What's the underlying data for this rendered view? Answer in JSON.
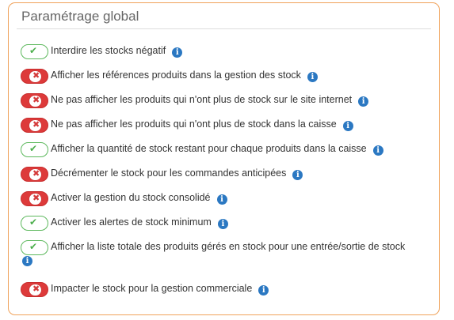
{
  "panel": {
    "title": "Paramétrage global"
  },
  "icons": {
    "info": "i",
    "check": "✔",
    "cross": "✖"
  },
  "settings": [
    {
      "label": "Interdire les stocks négatif",
      "enabled": true
    },
    {
      "label": "Afficher les références produits dans la gestion des stock",
      "enabled": false
    },
    {
      "label": "Ne pas afficher les produits qui n'ont plus de stock sur le site internet",
      "enabled": false
    },
    {
      "label": "Ne pas afficher les produits qui n'ont plus de stock dans la caisse",
      "enabled": false
    },
    {
      "label": "Afficher la quantité de stock restant pour chaque produits dans la caisse",
      "enabled": true
    },
    {
      "label": "Décrémenter le stock pour les commandes anticipées",
      "enabled": false
    },
    {
      "label": "Activer la gestion du stock consolidé",
      "enabled": false
    },
    {
      "label": "Activer les alertes de stock minimum",
      "enabled": true
    },
    {
      "label": "Afficher la liste totale des produits gérés en stock pour une entrée/sortie de stock",
      "enabled": true
    },
    {
      "label": "Impacter le stock pour la gestion commerciale",
      "enabled": false
    }
  ],
  "colors": {
    "panel_border": "#f0a25a",
    "toggle_on": "#5cb85c",
    "toggle_off": "#dd3a3a",
    "info_icon": "#2b78c2"
  }
}
